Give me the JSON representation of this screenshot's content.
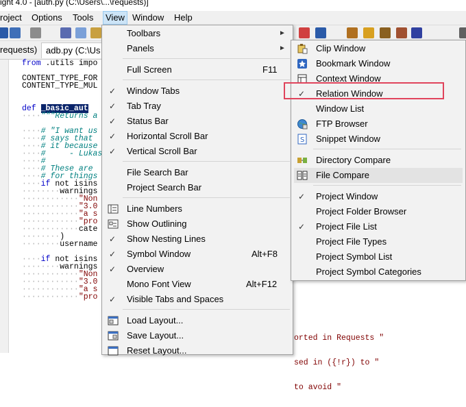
{
  "window": {
    "title": "ight 4.0 - [auth.py (C:\\Users\\...\\requests)]"
  },
  "menubar": {
    "items": [
      "roject",
      "Options",
      "Tools",
      "View",
      "Window",
      "Help"
    ],
    "active": "View"
  },
  "tabs": [
    {
      "label": "requests)"
    },
    {
      "label": "adb.py (C:\\Us"
    }
  ],
  "editor": {
    "lines": [
      "from .utils impo",
      "",
      "CONTENT_TYPE_FOR",
      "CONTENT_TYPE_MUL",
      "",
      "",
      "def _basic_aut",
      "    \"\"\"Returns a",
      "",
      "    # \"I want us",
      "    # says that ",
      "    # it because",
      "    #     - Lukas",
      "    #",
      "    # These are ",
      "    # for things",
      "    if not isins",
      "        warnings",
      "            \"Non",
      "            \"3.0",
      "            \"a s",
      "            \"pro",
      "            cate",
      "        )",
      "        username",
      "",
      "    if not isins",
      "        warnings",
      "            \"Non",
      "            \"3.0",
      "            \"a s",
      "            \"pro"
    ],
    "right_fragments": [
      "orted in Requests \"",
      "sed in ({!r}) to \"",
      "to avoid \""
    ]
  },
  "view_menu": {
    "items": [
      {
        "label": "Toolbars",
        "submenu": true
      },
      {
        "label": "Panels",
        "submenu": true,
        "highlighted": true
      },
      {
        "label": "Full Screen",
        "shortcut": "F11"
      },
      {
        "label": "Window Tabs",
        "checked": true
      },
      {
        "label": "Tab Tray",
        "checked": true
      },
      {
        "label": "Status Bar",
        "checked": true
      },
      {
        "label": "Horizontal Scroll Bar",
        "checked": true
      },
      {
        "label": "Vertical Scroll Bar",
        "checked": true
      },
      {
        "label": "File Search Bar"
      },
      {
        "label": "Project Search Bar"
      },
      {
        "label": "Line Numbers",
        "icon": "line-numbers-icon"
      },
      {
        "label": "Show Outlining",
        "icon": "outlining-icon"
      },
      {
        "label": "Show Nesting Lines",
        "checked": true
      },
      {
        "label": "Symbol Window",
        "checked": true,
        "shortcut": "Alt+F8"
      },
      {
        "label": "Overview",
        "checked": true
      },
      {
        "label": "Mono Font View",
        "shortcut": "Alt+F12"
      },
      {
        "label": "Visible Tabs and Spaces",
        "checked": true
      },
      {
        "label": "Load Layout...",
        "icon": "load-layout-icon"
      },
      {
        "label": "Save Layout...",
        "icon": "save-layout-icon"
      },
      {
        "label": "Reset Layout...",
        "icon": "reset-layout-icon"
      }
    ]
  },
  "panels_menu": {
    "items": [
      {
        "label": "Clip Window",
        "icon": "clip-window-icon"
      },
      {
        "label": "Bookmark Window",
        "icon": "bookmark-icon"
      },
      {
        "label": "Context Window",
        "icon": "context-window-icon"
      },
      {
        "label": "Relation Window",
        "checked": true,
        "outlined": true
      },
      {
        "label": "Window List"
      },
      {
        "label": "FTP Browser",
        "icon": "ftp-icon"
      },
      {
        "label": "Snippet Window",
        "icon": "snippet-icon"
      },
      {
        "label": "Directory Compare",
        "icon": "directory-compare-icon"
      },
      {
        "label": "File Compare",
        "icon": "file-compare-icon",
        "highlighted": true
      },
      {
        "label": "Project Window",
        "checked": true
      },
      {
        "label": "Project Folder Browser"
      },
      {
        "label": "Project File List",
        "checked": true
      },
      {
        "label": "Project File Types"
      },
      {
        "label": "Project Symbol List"
      },
      {
        "label": "Project Symbol Categories"
      }
    ]
  },
  "colors": {
    "accent_outline": "#e0435b",
    "selection": "#0a246a",
    "keyword": "#0000c8",
    "comment": "#008080"
  }
}
